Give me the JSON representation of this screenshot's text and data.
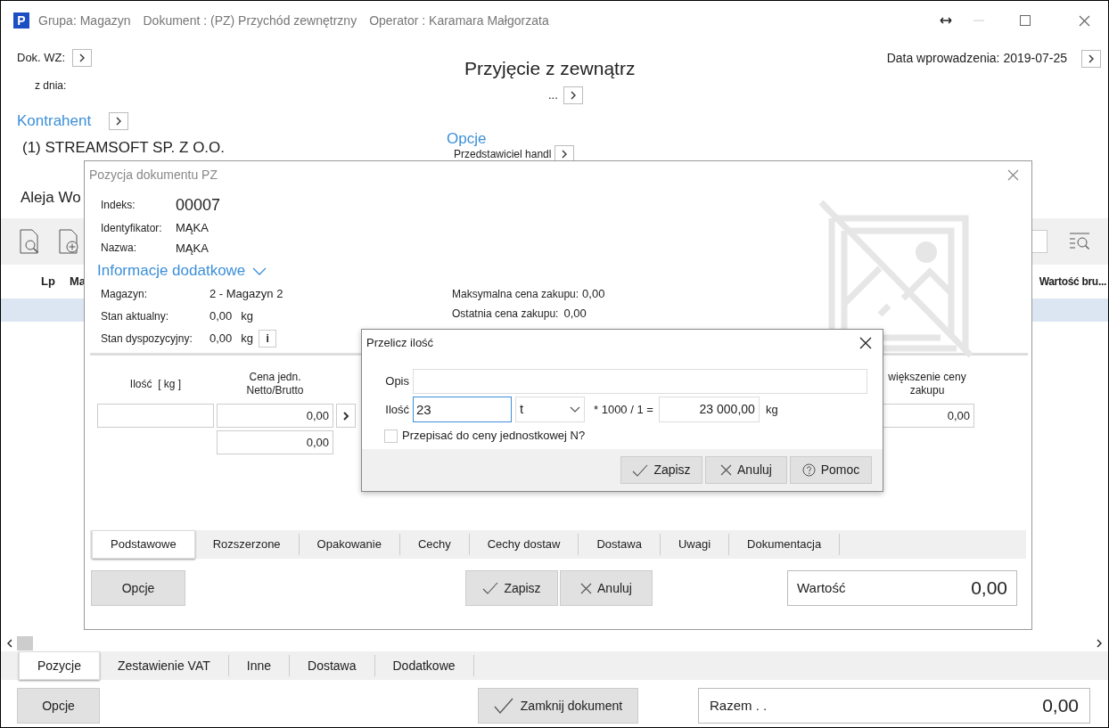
{
  "window": {
    "logo": "P",
    "title_parts": [
      "Grupa: Magazyn",
      "Dokument : (PZ) Przychód zewnętrzny",
      "Operator : Karamara Małgorzata"
    ]
  },
  "header": {
    "dok_wz_label": "Dok. WZ:",
    "z_dnia_label": "z dnia:",
    "title": "Przyjęcie z zewnątrz",
    "number": "...",
    "date_label": "Data wprowadzenia:",
    "date": "2019-07-25"
  },
  "kontrahent": {
    "heading": "Kontrahent",
    "name": "(1) STREAMSOFT SP. Z O.O.",
    "address": "Aleja Wo"
  },
  "options": {
    "heading": "Opcje",
    "representative_label": "Przedstawiciel handl"
  },
  "table": {
    "columns": [
      "Lp",
      "Ma",
      "Wartość bru..."
    ],
    "rows": [
      {
        "selected": true
      }
    ]
  },
  "bottom_tabs": [
    {
      "label": "Pozycje",
      "selected": true
    },
    {
      "label": "Zestawienie VAT",
      "selected": false
    },
    {
      "label": "Inne",
      "selected": false
    },
    {
      "label": "Dostawa",
      "selected": false
    },
    {
      "label": "Dodatkowe",
      "selected": false
    }
  ],
  "footer": {
    "options_button": "Opcje",
    "close_button": "Zamknij dokument",
    "total_label": "Razem . .",
    "total": "0,00"
  },
  "item_dialog": {
    "title": "Pozycja dokumentu PZ",
    "fields": [
      {
        "label": "Indeks:",
        "value": "00007",
        "kind": "large"
      },
      {
        "label": "Identyfikator:",
        "value": "MĄKA",
        "kind": "normal"
      },
      {
        "label": "Nazwa:",
        "value": "MĄKA",
        "kind": "normal"
      }
    ],
    "section": {
      "heading": "Informacje dodatkowe",
      "expanded": true
    },
    "info_left": [
      {
        "label": "Magazyn:",
        "value": "2 - Magazyn 2"
      },
      {
        "label": "Stan aktualny:",
        "value": "0,00",
        "unit": "kg"
      },
      {
        "label": "Stan dyspozycyjny:",
        "value": "0,00",
        "unit": "kg",
        "info_button": "i"
      }
    ],
    "info_right": [
      {
        "label": "Maksymalna cena zakupu:",
        "value": "0,00"
      },
      {
        "label": "Ostatnia cena zakupu:",
        "value": "0,00"
      }
    ],
    "quantity": {
      "label": "Ilość  [ kg ]"
    },
    "price": {
      "label_lines": [
        "Cena jedn.",
        "Netto/Brutto"
      ],
      "netto": "0,00",
      "brutto": "0,00"
    },
    "increase": {
      "label_lines": [
        "większenie ceny",
        "zakupu"
      ],
      "value": "0,00"
    },
    "tabs": [
      {
        "label": "Podstawowe",
        "selected": true
      },
      {
        "label": "Rozszerzone",
        "selected": false
      },
      {
        "label": "Opakowanie",
        "selected": false
      },
      {
        "label": "Cechy",
        "selected": false
      },
      {
        "label": "Cechy dostaw",
        "selected": false
      },
      {
        "label": "Dostawa",
        "selected": false
      },
      {
        "label": "Uwagi",
        "selected": false
      },
      {
        "label": "Dokumentacja",
        "selected": false
      }
    ],
    "buttons": {
      "options": "Opcje",
      "save": "Zapisz",
      "cancel": "Anuluj"
    },
    "value_label": "Wartość",
    "value": "0,00"
  },
  "convert_dialog": {
    "title": "Przelicz ilość",
    "description_label": "Opis",
    "quantity_label": "Ilość",
    "quantity": "23",
    "unit": "t",
    "formula": "* 1000 / 1 =",
    "result": "23 000,00",
    "result_unit": "kg",
    "checkbox": {
      "label": "Przepisać do ceny jednostkowej N?",
      "checked": false
    },
    "buttons": [
      "Zapisz",
      "Anuluj",
      "Pomoc"
    ]
  }
}
